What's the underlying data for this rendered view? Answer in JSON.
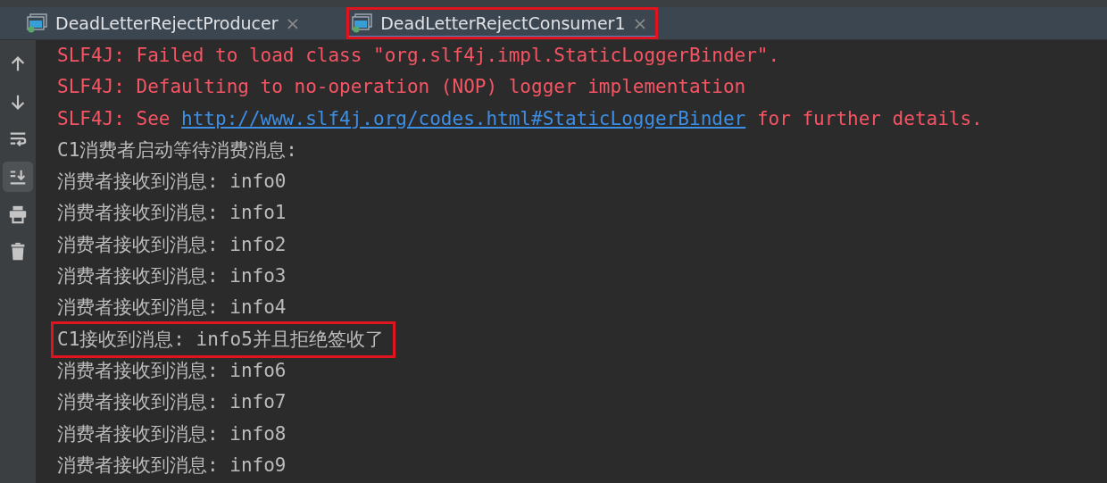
{
  "tabs": [
    {
      "label": "DeadLetterRejectProducer",
      "selected": false,
      "highlighted": false,
      "close": "×"
    },
    {
      "label": "DeadLetterRejectConsumer1",
      "selected": true,
      "highlighted": true,
      "close": "×"
    }
  ],
  "toolbar": [
    {
      "kind": "up",
      "on": false
    },
    {
      "kind": "down",
      "on": false
    },
    {
      "kind": "wrap",
      "on": false
    },
    {
      "kind": "scroll-end",
      "on": true
    },
    {
      "kind": "print",
      "on": false
    },
    {
      "kind": "trash",
      "on": false
    }
  ],
  "console_lines": [
    {
      "kind": "error",
      "highlighted": false,
      "parts": [
        {
          "text": "SLF4J: Failed to load class \"org.slf4j.impl.StaticLoggerBinder\"."
        }
      ]
    },
    {
      "kind": "error",
      "highlighted": false,
      "parts": [
        {
          "text": "SLF4J: Defaulting to no-operation (NOP) logger implementation"
        }
      ]
    },
    {
      "kind": "error",
      "highlighted": false,
      "parts": [
        {
          "text": "SLF4J: See "
        },
        {
          "text": "http://www.slf4j.org/codes.html#StaticLoggerBinder",
          "link": true
        },
        {
          "text": " for further details."
        }
      ]
    },
    {
      "kind": "output",
      "highlighted": false,
      "parts": [
        {
          "text": "C1消费者启动等待消费消息:"
        }
      ]
    },
    {
      "kind": "output",
      "highlighted": false,
      "parts": [
        {
          "text": "消费者接收到消息: info0"
        }
      ]
    },
    {
      "kind": "output",
      "highlighted": false,
      "parts": [
        {
          "text": "消费者接收到消息: info1"
        }
      ]
    },
    {
      "kind": "output",
      "highlighted": false,
      "parts": [
        {
          "text": "消费者接收到消息: info2"
        }
      ]
    },
    {
      "kind": "output",
      "highlighted": false,
      "parts": [
        {
          "text": "消费者接收到消息: info3"
        }
      ]
    },
    {
      "kind": "output",
      "highlighted": false,
      "parts": [
        {
          "text": "消费者接收到消息: info4"
        }
      ]
    },
    {
      "kind": "output",
      "highlighted": true,
      "parts": [
        {
          "text": "C1接收到消息: info5并且拒绝签收了"
        }
      ]
    },
    {
      "kind": "output",
      "highlighted": false,
      "parts": [
        {
          "text": "消费者接收到消息: info6"
        }
      ]
    },
    {
      "kind": "output",
      "highlighted": false,
      "parts": [
        {
          "text": "消费者接收到消息: info7"
        }
      ]
    },
    {
      "kind": "output",
      "highlighted": false,
      "parts": [
        {
          "text": "消费者接收到消息: info8"
        }
      ]
    },
    {
      "kind": "output",
      "highlighted": false,
      "parts": [
        {
          "text": "消费者接收到消息: info9"
        }
      ]
    }
  ]
}
